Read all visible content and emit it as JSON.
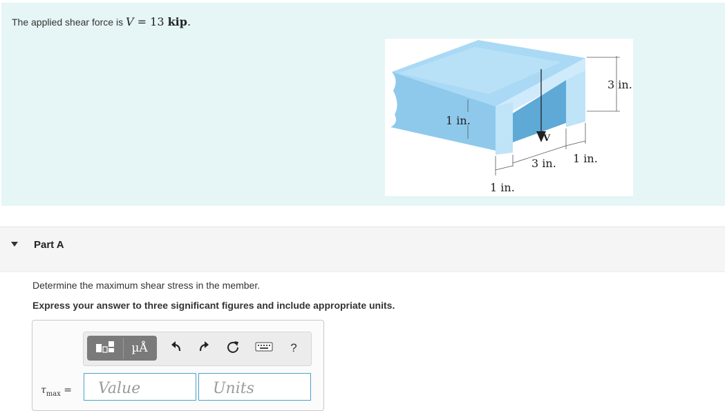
{
  "problem": {
    "prefix": "The applied shear force is",
    "symbol": "V",
    "equals": "=",
    "value": "13",
    "unit": "kip",
    "end": "."
  },
  "figure": {
    "dim_top_flange": "1 in.",
    "dim_height": "3 in.",
    "dim_gap": "3 in.",
    "dim_right_web": "1 in.",
    "dim_left_web": "1 in.",
    "force_label": "V"
  },
  "part": {
    "title": "Part A"
  },
  "question": {
    "text": "Determine the maximum shear stress in the member.",
    "instruction": "Express your answer to three significant figures and include appropriate units."
  },
  "toolbar": {
    "units_symbol": "µÅ",
    "help_symbol": "?",
    "icons": [
      "templates-icon",
      "units-icon",
      "undo-icon",
      "redo-icon",
      "reset-icon",
      "keyboard-icon",
      "help-icon"
    ]
  },
  "answer": {
    "var": "τ",
    "sub": "max",
    "equals": "=",
    "value_placeholder": "Value",
    "units_placeholder": "Units"
  },
  "colors": {
    "banner": "#e6f5f5",
    "field_border": "#4aa3c7",
    "beam_light": "#bfe3f7",
    "beam_mid": "#9fd2f0",
    "beam_dark": "#5ea9d6"
  }
}
